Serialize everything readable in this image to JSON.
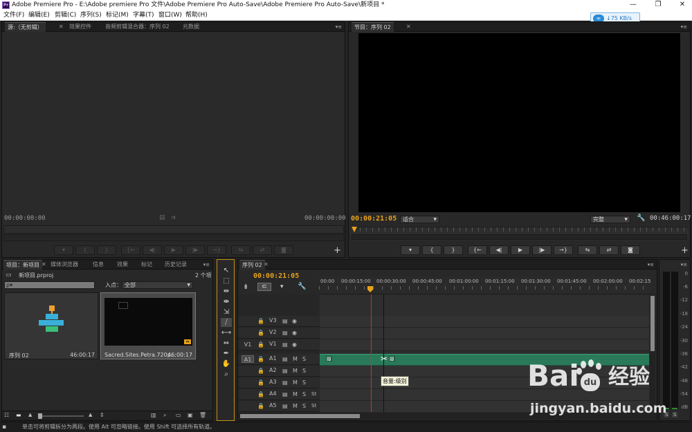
{
  "window": {
    "title": "Adobe Premiere Pro - E:\\Adobe premiere Pro 文件\\Adobe Premiere Pro Auto-Save\\Adobe Premiere Pro Auto-Save\\新项目 *",
    "logo": "Pr",
    "minimize": "—",
    "restore": "❐",
    "close": "✕"
  },
  "menu": [
    "文件(F)",
    "编辑(E)",
    "剪辑(C)",
    "序列(S)",
    "标记(M)",
    "字幕(T)",
    "窗口(W)",
    "帮助(H)"
  ],
  "net_badge": {
    "speed": "↓75 KB/s",
    "icon": "cloud-icon"
  },
  "source_panel": {
    "tabs": [
      "源:（无剪辑）",
      "效果控件",
      "音频剪辑混合器：序列 02",
      "元数据"
    ],
    "tc_left": "00:00:00:00",
    "tc_right": "00:00:00:00"
  },
  "program_panel": {
    "tab": "节目：序列 02",
    "tc_current": "00:00:21:05",
    "fit": "适合",
    "quality": "完整",
    "tc_duration": "00:46:00:17"
  },
  "transport_glyphs": [
    "▾",
    "{",
    "}",
    "{←",
    "◀|",
    "▶",
    "|▶",
    "→}",
    "⇆",
    "⇄",
    "◙"
  ],
  "project_panel": {
    "tabs": [
      "项目：新项目",
      "媒体浏览器",
      "信息",
      "效果",
      "标记",
      "历史记录"
    ],
    "item_count": "2 个项",
    "project_file": "新项目.prproj",
    "search_placeholder": "ρ▾",
    "in_point_label": "入点：",
    "in_point_value": "全部",
    "items": [
      {
        "name": "序列 02",
        "duration": "46:00:17"
      },
      {
        "name": "Sacred.Sites.Petra.720p...",
        "duration": "46:00:17"
      }
    ]
  },
  "timeline": {
    "tab": "序列 02",
    "tc_current": "00:00:21:05",
    "ruler": [
      "00:00",
      "00:00:15:00",
      "00:00:30:00",
      "00:00:45:00",
      "00:01:00:00",
      "00:01:15:00",
      "00:01:30:00",
      "00:01:45:00",
      "00:02:00:00",
      "00:02:15"
    ],
    "video_tracks": [
      "V3",
      "V2",
      "V1"
    ],
    "audio_tracks": [
      "A1",
      "A2",
      "A3",
      "A4",
      "A5"
    ],
    "src_v": "V1",
    "src_a": "A1",
    "tooltip": "音量:级别",
    "lock": "🔒",
    "mute": "M",
    "solo": "S",
    "voice": "St"
  },
  "meter": {
    "labels": [
      "0",
      "-6",
      "-12",
      "-18",
      "-24",
      "-30",
      "-36",
      "-42",
      "-48",
      "-54",
      "dB"
    ],
    "solo_left": "S",
    "solo_right": "S"
  },
  "status_text": "单击可将剪辑拆分为两段。使用 Alt 可忽略链接。使用 Shift 可选择所有轨道。",
  "watermark": {
    "brand": "Bai",
    "paw": "du",
    "jingyan": "经验",
    "url": "jingyan.baidu.com"
  },
  "colors": {
    "accent_orange": "#e8a21a",
    "audio_clip": "#2a7a5a",
    "playhead": "#d03030"
  }
}
